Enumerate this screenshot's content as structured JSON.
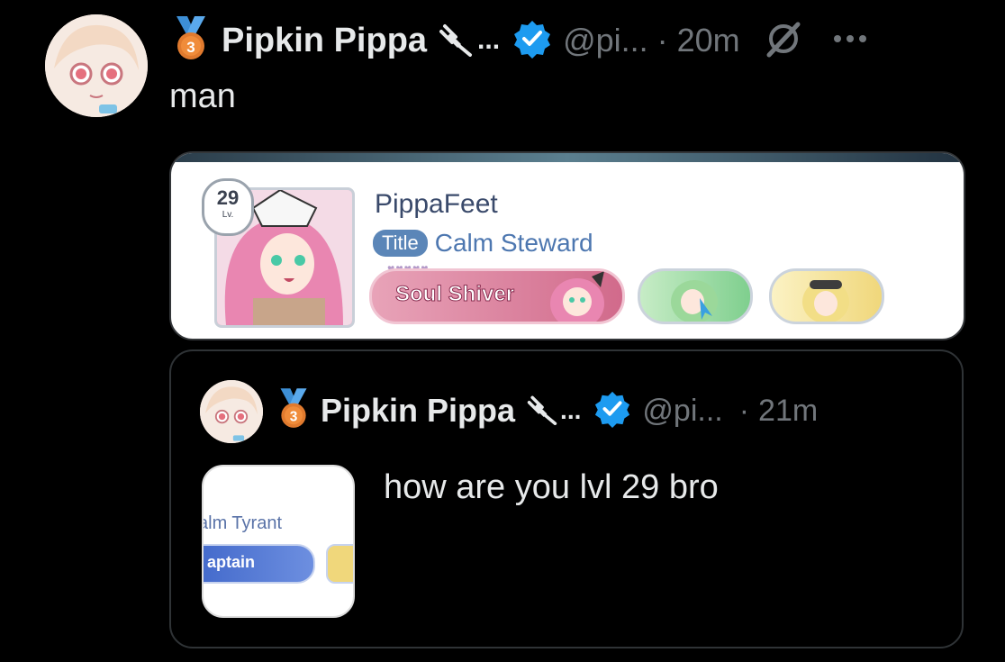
{
  "tweet": {
    "display_name": "Pipkin Pippa",
    "name_suffix": "...",
    "handle": "@pi...",
    "separator": "·",
    "time": "20m",
    "body": "man",
    "medal_number": "3",
    "verified_color": "#1d9bf0"
  },
  "card": {
    "level": "29",
    "level_label": "Lv.",
    "player_name": "PippaFeet",
    "title_tag": "Title",
    "title_value": "Calm Steward",
    "team_label": "Soul Shiver",
    "hearts": "♥♥♥♥♥"
  },
  "quote": {
    "display_name": "Pipkin Pippa",
    "name_suffix": "...",
    "handle": "@pi...",
    "separator": "·",
    "time": "21m",
    "body": "how are you lvl 29 bro",
    "medal_number": "3",
    "thumb_title": "alm Tyrant",
    "thumb_pill": "aptain"
  }
}
